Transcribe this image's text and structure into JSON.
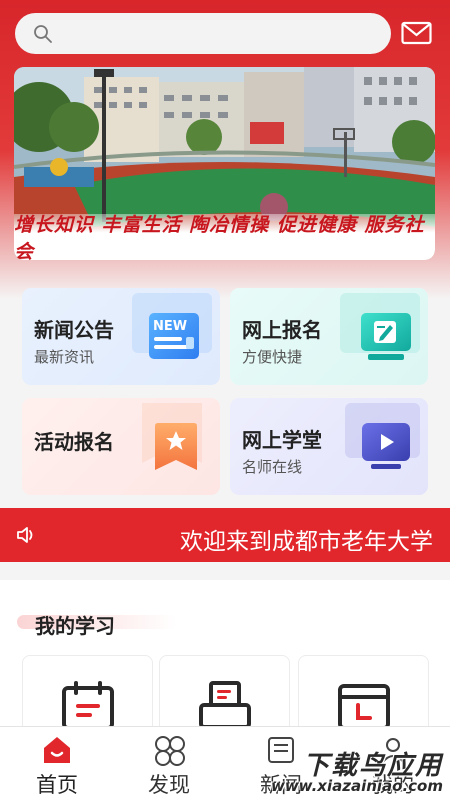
{
  "header": {
    "search_placeholder": "",
    "mail_icon": "mail-icon"
  },
  "banner": {
    "caption": "增长知识 丰富生活 陶冶情操 促进健康 服务社会"
  },
  "cards": [
    {
      "title": "新闻公告",
      "subtitle": "最新资讯",
      "icon": "news-icon",
      "icon_text": "NEW"
    },
    {
      "title": "网上报名",
      "subtitle": "方便快捷",
      "icon": "online-signup-icon"
    },
    {
      "title": "活动报名",
      "subtitle": "",
      "icon": "activity-badge-icon"
    },
    {
      "title": "网上学堂",
      "subtitle": "名师在线",
      "icon": "video-play-icon"
    }
  ],
  "notice": {
    "text": "欢迎来到成都市老年大学",
    "icon": "speaker-icon"
  },
  "my_study": {
    "title": "我的学习",
    "items": [
      {
        "icon": "calendar-icon"
      },
      {
        "icon": "printer-icon"
      },
      {
        "icon": "calendar-l-icon"
      }
    ]
  },
  "tabbar": {
    "items": [
      {
        "label": "首页",
        "icon": "home-icon",
        "active": true
      },
      {
        "label": "发现",
        "icon": "discover-icon",
        "active": false
      },
      {
        "label": "新闻",
        "icon": "news-tab-icon",
        "active": false
      },
      {
        "label": "我的",
        "icon": "profile-icon",
        "active": false
      }
    ]
  },
  "watermark": {
    "name": "下载鸟应用",
    "url": "www.xiazainiao.com"
  },
  "colors": {
    "brand_red": "#e1262c",
    "news_blue": "#3b8ff5",
    "signup_teal": "#1cc3b4",
    "activity_orange": "#f38a50",
    "school_indigo": "#4a4fc9"
  }
}
